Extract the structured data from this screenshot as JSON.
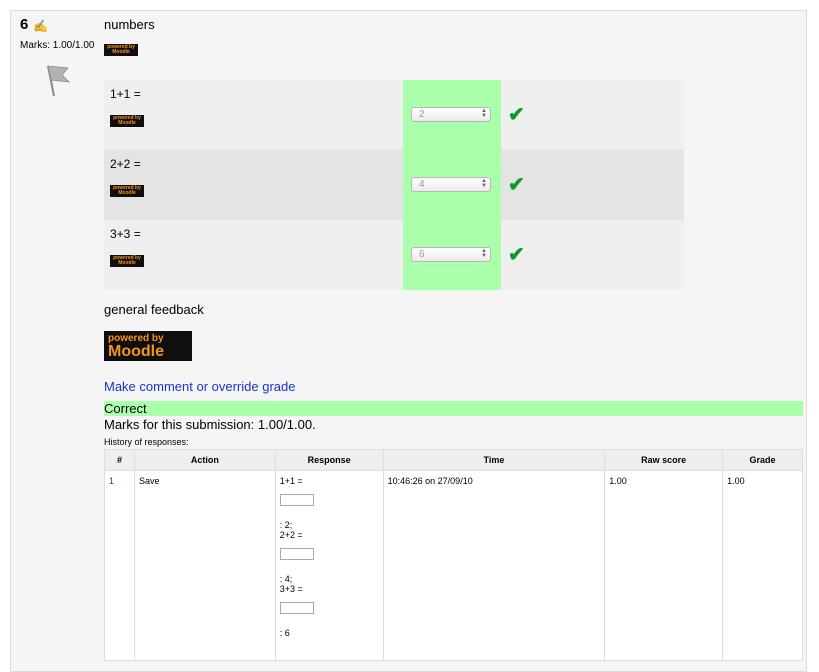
{
  "question": {
    "number": "6",
    "marks": "Marks: 1.00/1.00",
    "text": "numbers",
    "logo_line1": "powered by",
    "logo_line2": "Moodle"
  },
  "matches": [
    {
      "stem": "1+1 =",
      "answer": "2"
    },
    {
      "stem": "2+2 =",
      "answer": "4"
    },
    {
      "stem": "3+3 =",
      "answer": "6"
    }
  ],
  "general_feedback": "general feedback",
  "comment_link": "Make comment or override grade",
  "result": "Correct",
  "submission_marks": "Marks for this submission: 1.00/1.00.",
  "history_label": "History of responses:",
  "history": {
    "headers": [
      "#",
      "Action",
      "Response",
      "Time",
      "Raw score",
      "Grade"
    ],
    "rows": [
      {
        "num": "1",
        "action": "Save",
        "response": [
          "1+1 =",
          ": 2;",
          "2+2 =",
          ": 4;",
          "3+3 =",
          ": 6"
        ],
        "time": "10:46:26 on 27/09/10",
        "raw_score": "1.00",
        "grade": "1.00"
      }
    ]
  },
  "colors": {
    "correct": "#aaffaa",
    "tick": "#0a9a2a",
    "link": "#1a33cc"
  },
  "icons": [
    "edit-icon",
    "flag-icon",
    "tick-icon",
    "moodle-logo"
  ]
}
